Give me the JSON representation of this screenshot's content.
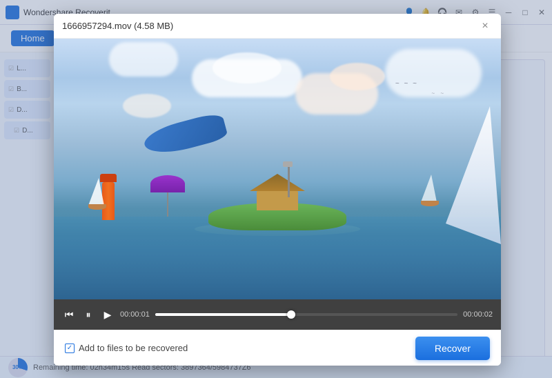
{
  "app": {
    "title": "Wondershare Recoverit",
    "icon_label": "recoverit-icon"
  },
  "title_bar": {
    "controls": [
      "minimize",
      "maximize",
      "close"
    ]
  },
  "nav": {
    "home_label": "Home"
  },
  "modal": {
    "title": "1666957294.mov (4.58 MB)",
    "close_label": "×"
  },
  "video": {
    "current_time": "00:00:01",
    "total_time": "00:00:02",
    "progress_percent": 45
  },
  "footer": {
    "checkbox_label": "Add to files to be recovered",
    "checkbox_checked": true,
    "recover_button_label": "Recover"
  },
  "status_bar": {
    "percentage": "30%",
    "text": "Remaining time: 02h34m15s     Read sectors: 3897364/5984737Z6"
  }
}
